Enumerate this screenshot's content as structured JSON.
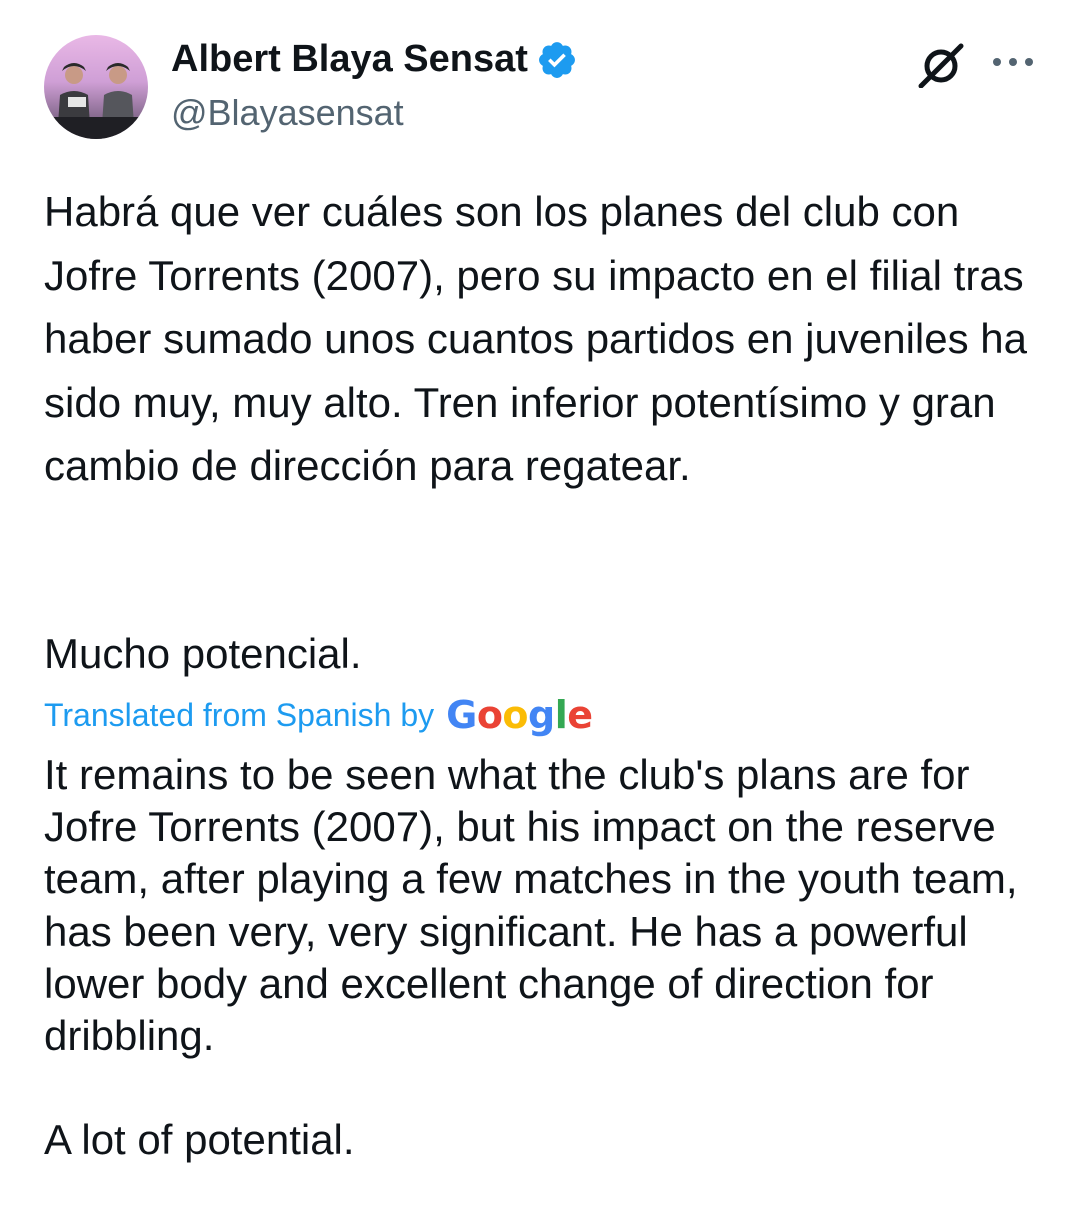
{
  "author": {
    "display_name": "Albert Blaya Sensat",
    "handle": "@Blayasensat",
    "verified": true,
    "avatar_icon": "profile-photo"
  },
  "actions": {
    "grok_icon": "grok-icon",
    "more_icon": "more-horizontal-icon"
  },
  "tweet": {
    "text_paragraph_1": "Habrá que ver cuáles son los planes del club con Jofre Torrents (2007), pero su impacto en el filial tras haber sumado unos cuantos partidos en juveniles ha sido muy, muy alto. Tren inferior potentísimo y gran cambio de dirección para regatear.",
    "text_paragraph_2": "Mucho potencial."
  },
  "translation": {
    "label": "Translated from Spanish by",
    "provider": "Google",
    "text_paragraph_1": "It remains to be seen what the club's plans are for Jofre Torrents (2007), but his impact on the reserve team, after playing a few matches in the youth team, has been very, very significant. He has a powerful lower body and excellent change of direction for dribbling.",
    "text_paragraph_2": "A lot of potential."
  },
  "colors": {
    "text_primary": "#0f1419",
    "text_secondary": "#536471",
    "accent_blue": "#1d9bf0",
    "verified_badge": "#1d9bf0"
  }
}
